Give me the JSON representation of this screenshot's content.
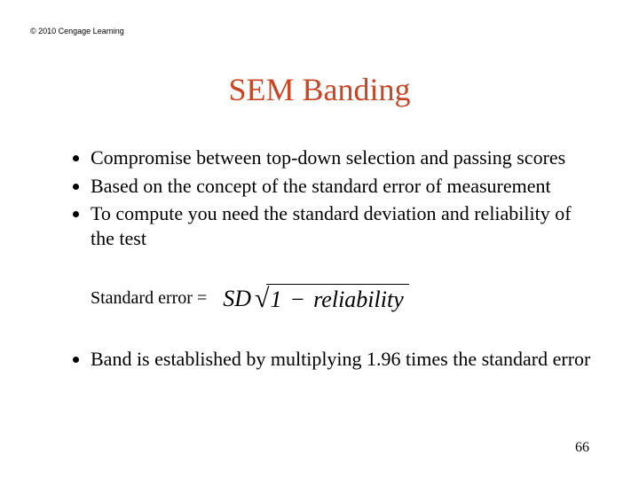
{
  "copyright": "© 2010 Cengage Learning",
  "title": "SEM Banding",
  "bullets_top": [
    "Compromise between top-down selection and passing scores",
    "Based on the concept of the standard error of measurement",
    "To compute you need the standard deviation and reliability of the test"
  ],
  "formula": {
    "label": "Standard error =",
    "sd": "SD",
    "radicand_left": "1",
    "radicand_op": "−",
    "radicand_right": "reliability"
  },
  "bullets_bottom": [
    "Band is established by multiplying 1.96 times the standard error"
  ],
  "page_number": "66"
}
